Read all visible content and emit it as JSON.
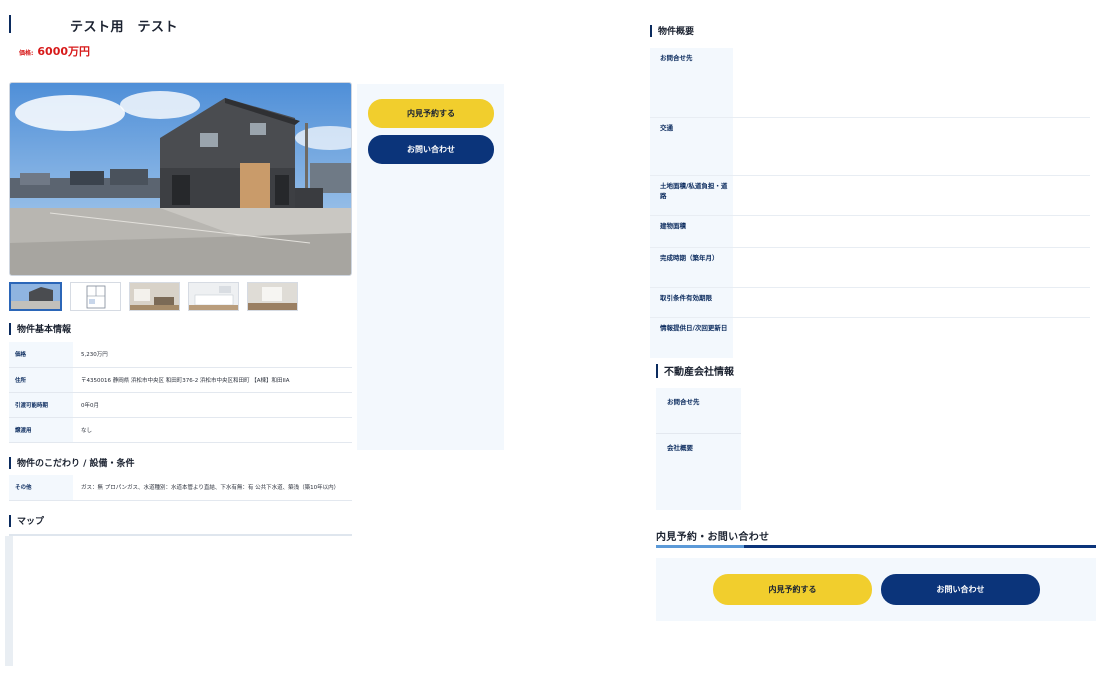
{
  "header": {
    "title": "テスト用　テスト",
    "price_label": "価格:",
    "price_value": "6000万円"
  },
  "actions": {
    "viewing_button": "内見予約する",
    "contact_button": "お問い合わせ"
  },
  "basic_info": {
    "heading": "物件基本情報",
    "rows": [
      {
        "label": "価格",
        "value": "5,230万円"
      },
      {
        "label": "住所",
        "value": "〒4350016 静岡県 浜松市中央区 和田町376-2 浜松市中央区和田町 【A棟】和田IIA"
      },
      {
        "label": "引渡可能時期",
        "value": "0年0月"
      },
      {
        "label": "譲渡用",
        "value": "なし"
      }
    ]
  },
  "features": {
    "heading": "物件のこだわり / 設備・条件",
    "rows": [
      {
        "label": "その他",
        "value": "ガス：無 プロパンガス、水道種別：水道本管より直結、下水有無：有 公共下水道、築浅（築10年以内）"
      }
    ]
  },
  "map": {
    "heading": "マップ"
  },
  "overview": {
    "heading": "物件概要",
    "rows": [
      {
        "label": "お問合せ先"
      },
      {
        "label": "交通"
      },
      {
        "label": "土地面積/私道負担・道路"
      },
      {
        "label": "建物面積"
      },
      {
        "label": "完成時期（築年月）"
      },
      {
        "label": "取引条件有効期限"
      },
      {
        "label": "情報提供日/次回更新日"
      }
    ]
  },
  "company": {
    "heading": "不動産会社情報",
    "rows": [
      {
        "label": "お問合せ先"
      },
      {
        "label": "会社概要"
      }
    ]
  },
  "inquiry": {
    "heading": "内見予約・お問い合わせ",
    "viewing_button": "内見予約する",
    "contact_button": "お問い合わせ"
  },
  "colors": {
    "navy": "#0b347a",
    "yellow": "#f1ce2d",
    "price_red": "#d71a1a",
    "panel_bg": "#f3f8fd"
  },
  "gallery": {
    "thumbnail_count": 5,
    "active_index": 0
  }
}
